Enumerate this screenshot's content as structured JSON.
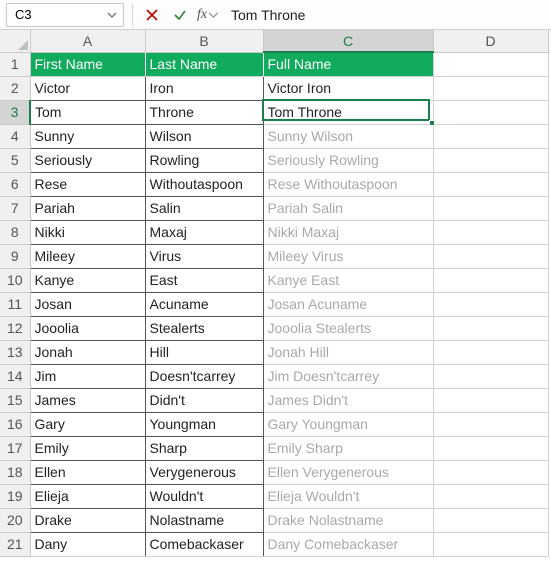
{
  "formula_bar": {
    "name_box": "C3",
    "formula_value": "Tom Throne"
  },
  "columns": [
    "A",
    "B",
    "C",
    "D"
  ],
  "selected_col_index": 2,
  "header_row": {
    "a": "First Name",
    "b": "Last Name",
    "c": "Full Name"
  },
  "active_cell": {
    "row": 3,
    "col": "C"
  },
  "rows": [
    {
      "n": 2,
      "a": "Victor",
      "b": "Iron",
      "c": "Victor Iron",
      "ghost": false
    },
    {
      "n": 3,
      "a": "Tom",
      "b": "Throne",
      "c": "Tom Throne",
      "ghost": false
    },
    {
      "n": 4,
      "a": "Sunny",
      "b": "Wilson",
      "c": "Sunny Wilson",
      "ghost": true
    },
    {
      "n": 5,
      "a": "Seriously",
      "b": "Rowling",
      "c": "Seriously Rowling",
      "ghost": true
    },
    {
      "n": 6,
      "a": "Rese",
      "b": "Withoutaspoon",
      "c": "Rese Withoutaspoon",
      "ghost": true
    },
    {
      "n": 7,
      "a": "Pariah",
      "b": "Salin",
      "c": "Pariah Salin",
      "ghost": true
    },
    {
      "n": 8,
      "a": "Nikki",
      "b": "Maxaj",
      "c": "Nikki Maxaj",
      "ghost": true
    },
    {
      "n": 9,
      "a": "Mileey",
      "b": "Virus",
      "c": "Mileey Virus",
      "ghost": true
    },
    {
      "n": 10,
      "a": "Kanye",
      "b": "East",
      "c": "Kanye East",
      "ghost": true
    },
    {
      "n": 11,
      "a": "Josan",
      "b": "Acuname",
      "c": "Josan Acuname",
      "ghost": true
    },
    {
      "n": 12,
      "a": "Jooolia",
      "b": "Stealerts",
      "c": "Jooolia Stealerts",
      "ghost": true
    },
    {
      "n": 13,
      "a": "Jonah",
      "b": "Hill",
      "c": "Jonah Hill",
      "ghost": true
    },
    {
      "n": 14,
      "a": "Jim",
      "b": "Doesn'tcarrey",
      "c": "Jim Doesn'tcarrey",
      "ghost": true
    },
    {
      "n": 15,
      "a": "James",
      "b": "Didn't",
      "c": "James Didn't",
      "ghost": true
    },
    {
      "n": 16,
      "a": "Gary",
      "b": "Youngman",
      "c": "Gary Youngman",
      "ghost": true
    },
    {
      "n": 17,
      "a": "Emily",
      "b": "Sharp",
      "c": "Emily Sharp",
      "ghost": true
    },
    {
      "n": 18,
      "a": "Ellen",
      "b": "Verygenerous",
      "c": "Ellen Verygenerous",
      "ghost": true
    },
    {
      "n": 19,
      "a": "Elieja",
      "b": "Wouldn't",
      "c": "Elieja Wouldn't",
      "ghost": true
    },
    {
      "n": 20,
      "a": "Drake",
      "b": "Nolastname",
      "c": "Drake Nolastname",
      "ghost": true
    },
    {
      "n": 21,
      "a": "Dany",
      "b": "Comebackaser",
      "c": "Dany Comebackaser",
      "ghost": true
    }
  ]
}
